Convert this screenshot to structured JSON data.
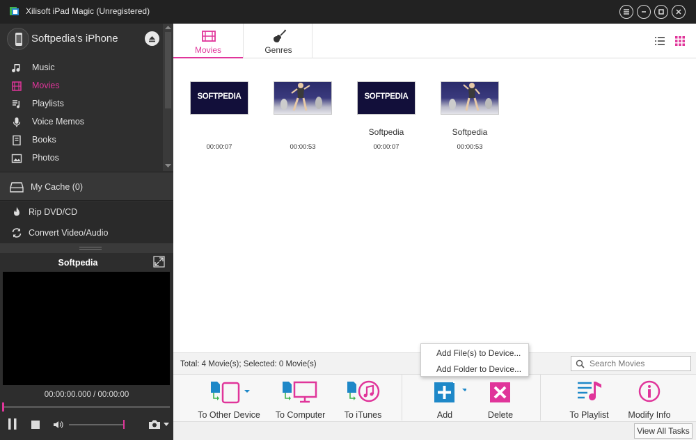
{
  "window": {
    "title": "Xilisoft iPad Magic (Unregistered)"
  },
  "device": {
    "name": "Softpedia's iPhone"
  },
  "nav": {
    "items": [
      {
        "label": "Music",
        "icon": "music-note-icon"
      },
      {
        "label": "Movies",
        "icon": "film-icon",
        "active": true
      },
      {
        "label": "Playlists",
        "icon": "playlist-icon"
      },
      {
        "label": "Voice Memos",
        "icon": "microphone-icon"
      },
      {
        "label": "Books",
        "icon": "book-icon"
      },
      {
        "label": "Photos",
        "icon": "photo-icon"
      }
    ]
  },
  "cache": {
    "label": "My Cache (0)"
  },
  "tools": {
    "rip": "Rip DVD/CD",
    "convert": "Convert Video/Audio"
  },
  "player": {
    "title": "Softpedia",
    "time": "00:00:00.000 / 00:00:00"
  },
  "tabs": {
    "movies": "Movies",
    "genres": "Genres"
  },
  "movies": [
    {
      "thumb": "softpedia",
      "caption": "",
      "duration": "00:00:07",
      "logo": "SOFTPEDIA"
    },
    {
      "thumb": "dance",
      "caption": "",
      "duration": "00:00:53"
    },
    {
      "thumb": "softpedia",
      "caption": "Softpedia",
      "duration": "00:00:07",
      "logo": "SOFTPEDIA"
    },
    {
      "thumb": "dance",
      "caption": "Softpedia",
      "duration": "00:00:53"
    }
  ],
  "status": {
    "text": "Total: 4 Movie(s); Selected: 0 Movie(s)"
  },
  "search": {
    "placeholder": "Search Movies"
  },
  "toolbar": {
    "to_other_device": "To Other Device",
    "to_computer": "To Computer",
    "to_itunes": "To iTunes",
    "add": "Add",
    "delete": "Delete",
    "to_playlist": "To Playlist",
    "modify_info": "Modify Info"
  },
  "add_menu": {
    "add_files": "Add File(s) to Device...",
    "add_folder": "Add Folder to Device..."
  },
  "footer": {
    "view_all_tasks": "View All Tasks"
  },
  "colors": {
    "accent": "#e0359a",
    "blue": "#1e88c8",
    "dark": "#2f2f2f"
  }
}
